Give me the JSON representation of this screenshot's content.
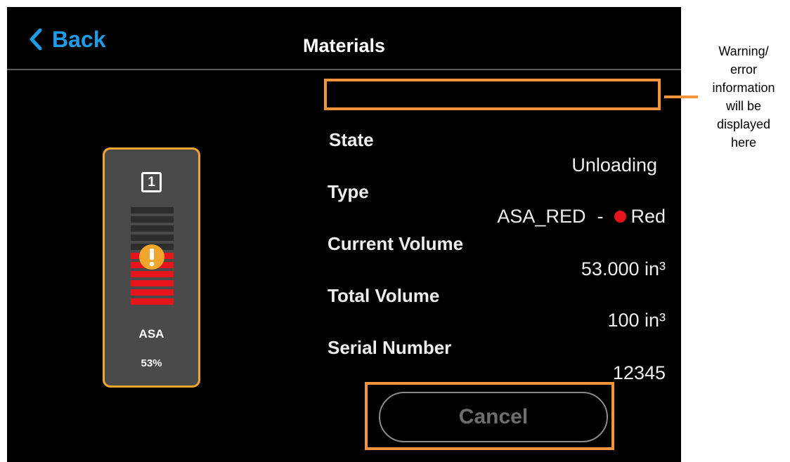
{
  "header": {
    "back_label": "Back",
    "title": "Materials"
  },
  "cartridge": {
    "slot_number": "1",
    "material": "ASA",
    "level_percent_label": "53%",
    "level_fraction": 0.53,
    "segments_total": 11,
    "status_icon": "warning-icon",
    "empty_color": "#2d2d2d",
    "fill_color": "#e8141b",
    "border_color": "#f0a62c",
    "warning_color": "#f0a62c"
  },
  "details": {
    "state_label": "State",
    "state_value": "Unloading",
    "type_label": "Type",
    "type_value": "ASA_RED",
    "type_separator": "-",
    "color_name": "Red",
    "color_hex": "#e8141b",
    "current_volume_label": "Current Volume",
    "current_volume_value": "53.000 in³",
    "total_volume_label": "Total Volume",
    "total_volume_value": "100 in³",
    "serial_label": "Serial Number",
    "serial_value": "12345"
  },
  "actions": {
    "cancel_label": "Cancel"
  },
  "annotation": {
    "lines": [
      "Warning/",
      "error",
      "information",
      "will be",
      "displayed",
      "here"
    ],
    "highlight_color": "#f5943c"
  },
  "colors": {
    "accent": "#1e9ce6",
    "background": "#000000"
  }
}
